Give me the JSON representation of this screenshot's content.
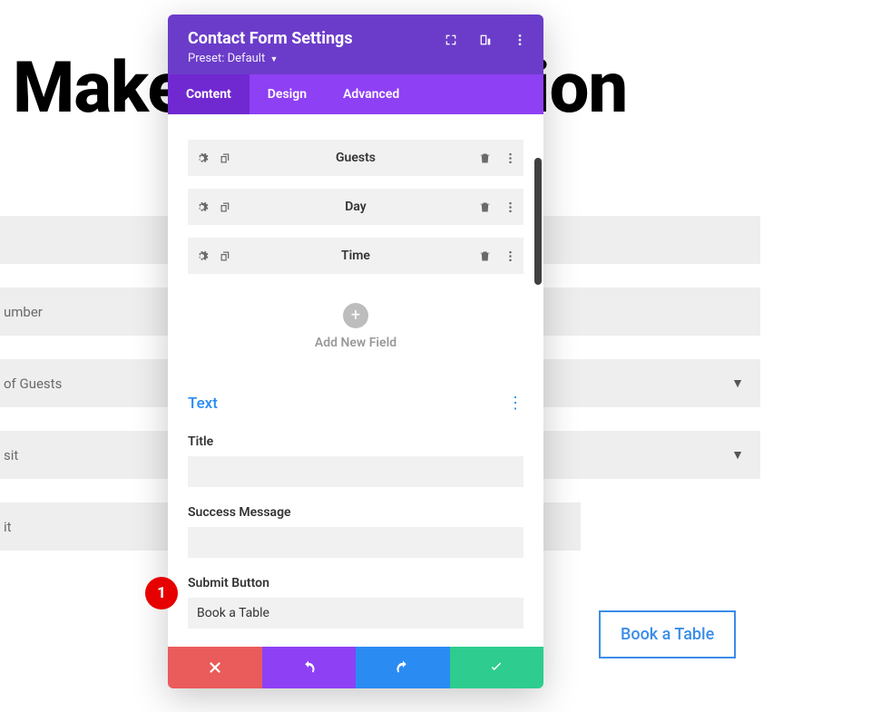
{
  "bg": {
    "heading": "Make a Reservation",
    "inputs": {
      "row1": "",
      "phone": "umber",
      "guests": "of Guests",
      "day": "sit",
      "time": "it"
    },
    "button": "Book a Table"
  },
  "modal": {
    "title": "Contact Form Settings",
    "preset_label": "Preset:",
    "preset_value": "Default",
    "tabs": {
      "content": "Content",
      "design": "Design",
      "advanced": "Advanced"
    },
    "fields": [
      {
        "name": "Guests"
      },
      {
        "name": "Day"
      },
      {
        "name": "Time"
      }
    ],
    "add_label": "Add New Field",
    "text_section": {
      "title": "Text",
      "title_label": "Title",
      "title_value": "",
      "success_label": "Success Message",
      "success_value": "",
      "submit_label": "Submit Button",
      "submit_value": "Book a Table"
    }
  },
  "marker": "1"
}
